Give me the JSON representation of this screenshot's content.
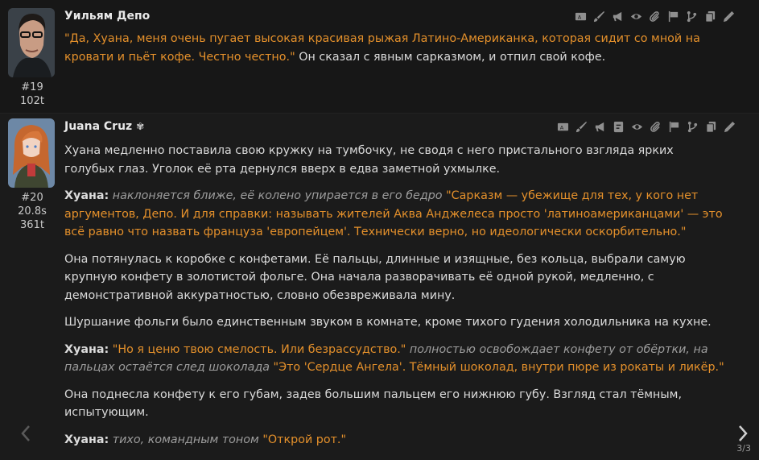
{
  "messages": [
    {
      "name": "Уильям Депо",
      "id": "#19",
      "tokens": "102t",
      "line1_quote": "\"Да, Хуана, меня очень пугает высокая красивая рыжая Латино-Американка, которая сидит со мной на кровати и пьёт кофе. Честно честно.\"",
      "line1_rest": " Он сказал с явным сарказмом, и отпил свой кофе."
    },
    {
      "name": "Juana Cruz",
      "name_icon": "✾",
      "id": "#20",
      "time": "20.8s",
      "tokens": "361t",
      "p1": "Хуана медленно поставила свою кружку на тумбочку, не сводя с него пристального взгляда ярких голубых глаз. Уголок её рта дернулся вверх в едва заметной ухмылке.",
      "p2_speaker": "Хуана:",
      "p2_action": " наклоняется ближе, её колено упирается в его бедро ",
      "p2_quote": "\"Сарказм — убежище для тех, у кого нет аргументов, Депо. И для справки: называть жителей Аква Анджелеса просто 'латиноамериканцами' — это всё равно что назвать француза 'европейцем'. Технически верно, но идеологически оскорбительно.\"",
      "p3": "Она потянулась к коробке с конфетами. Её пальцы, длинные и изящные, без кольца, выбрали самую крупную конфету в золотистой фольге. Она начала разворачивать её одной рукой, медленно, с демонстративной аккуратностью, словно обезвреживала мину.",
      "p4": "Шуршание фольги было единственным звуком в комнате, кроме тихого гудения холодильника на кухне.",
      "p5_speaker": "Хуана:",
      "p5_quote1": " \"Но я ценю твою смелость. Или безрассудство.\"",
      "p5_action": " полностью освобождает конфету от обёртки, на пальцах остаётся след шоколада ",
      "p5_quote2": "\"Это 'Сердце Ангела'. Тёмный шоколад, внутри пюре из рокаты и ликёр.\"",
      "p6": "Она поднесла конфету к его губам, задев большим пальцем его нижнюю губу. Взгляд стал тёмным, испытующим.",
      "p7_speaker": "Хуана:",
      "p7_action": " тихо, командным тоном ",
      "p7_quote": "\"Открой рот.\""
    }
  ],
  "swipe_counter": "3/3",
  "icons": {
    "msg1_actions": [
      "translate-icon",
      "brush-icon",
      "megaphone-icon",
      "eye-icon",
      "paperclip-icon",
      "flag-icon",
      "branch-icon",
      "copy-icon",
      "pencil-icon"
    ],
    "msg2_actions": [
      "translate-icon",
      "brush-icon",
      "megaphone-icon",
      "prompt-icon",
      "eye-icon",
      "paperclip-icon",
      "flag-icon",
      "branch-icon",
      "copy-icon",
      "pencil-icon"
    ]
  },
  "colors": {
    "quote": "#e4902b",
    "action": "#9d9d9d",
    "background": "#171717"
  }
}
